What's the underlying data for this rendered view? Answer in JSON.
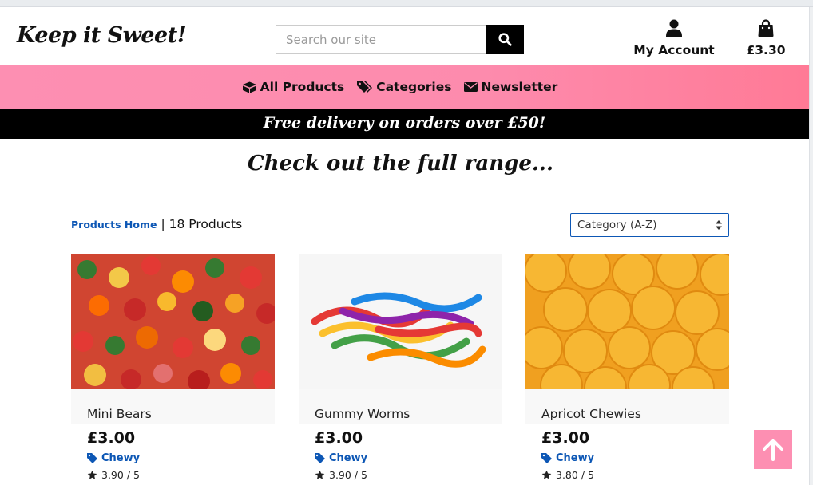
{
  "header": {
    "logo": "Keep it Sweet!",
    "search_placeholder": "Search our site",
    "search_icon": "search-icon",
    "account_label": "My Account",
    "account_icon": "user-icon",
    "bag_total": "£3.30",
    "bag_icon": "shopping-bag-icon"
  },
  "nav": {
    "items": [
      {
        "label": "All Products",
        "icon": "boxes-icon"
      },
      {
        "label": "Categories",
        "icon": "tags-icon"
      },
      {
        "label": "Newsletter",
        "icon": "envelope-icon"
      }
    ],
    "gradient": [
      "#fd8fb2",
      "#ff7a96"
    ]
  },
  "promo": "Free delivery on orders over £50!",
  "page": {
    "title": "Check out the full range...",
    "breadcrumb_link": "Products Home",
    "breadcrumb_separator": "|",
    "product_count": "18 Products",
    "sort_value": "Category (A-Z)"
  },
  "products": [
    {
      "name": "Mini Bears",
      "price": "£3.00",
      "category": "Chewy",
      "rating": "3.90 / 5"
    },
    {
      "name": "Gummy Worms",
      "price": "£3.00",
      "category": "Chewy",
      "rating": "3.90 / 5"
    },
    {
      "name": "Apricot Chewies",
      "price": "£3.00",
      "category": "Chewy",
      "rating": "3.80 / 5"
    }
  ],
  "colors": {
    "accent_pink": "#fd8fb2",
    "link_blue": "#0d57b5",
    "black": "#000000"
  }
}
